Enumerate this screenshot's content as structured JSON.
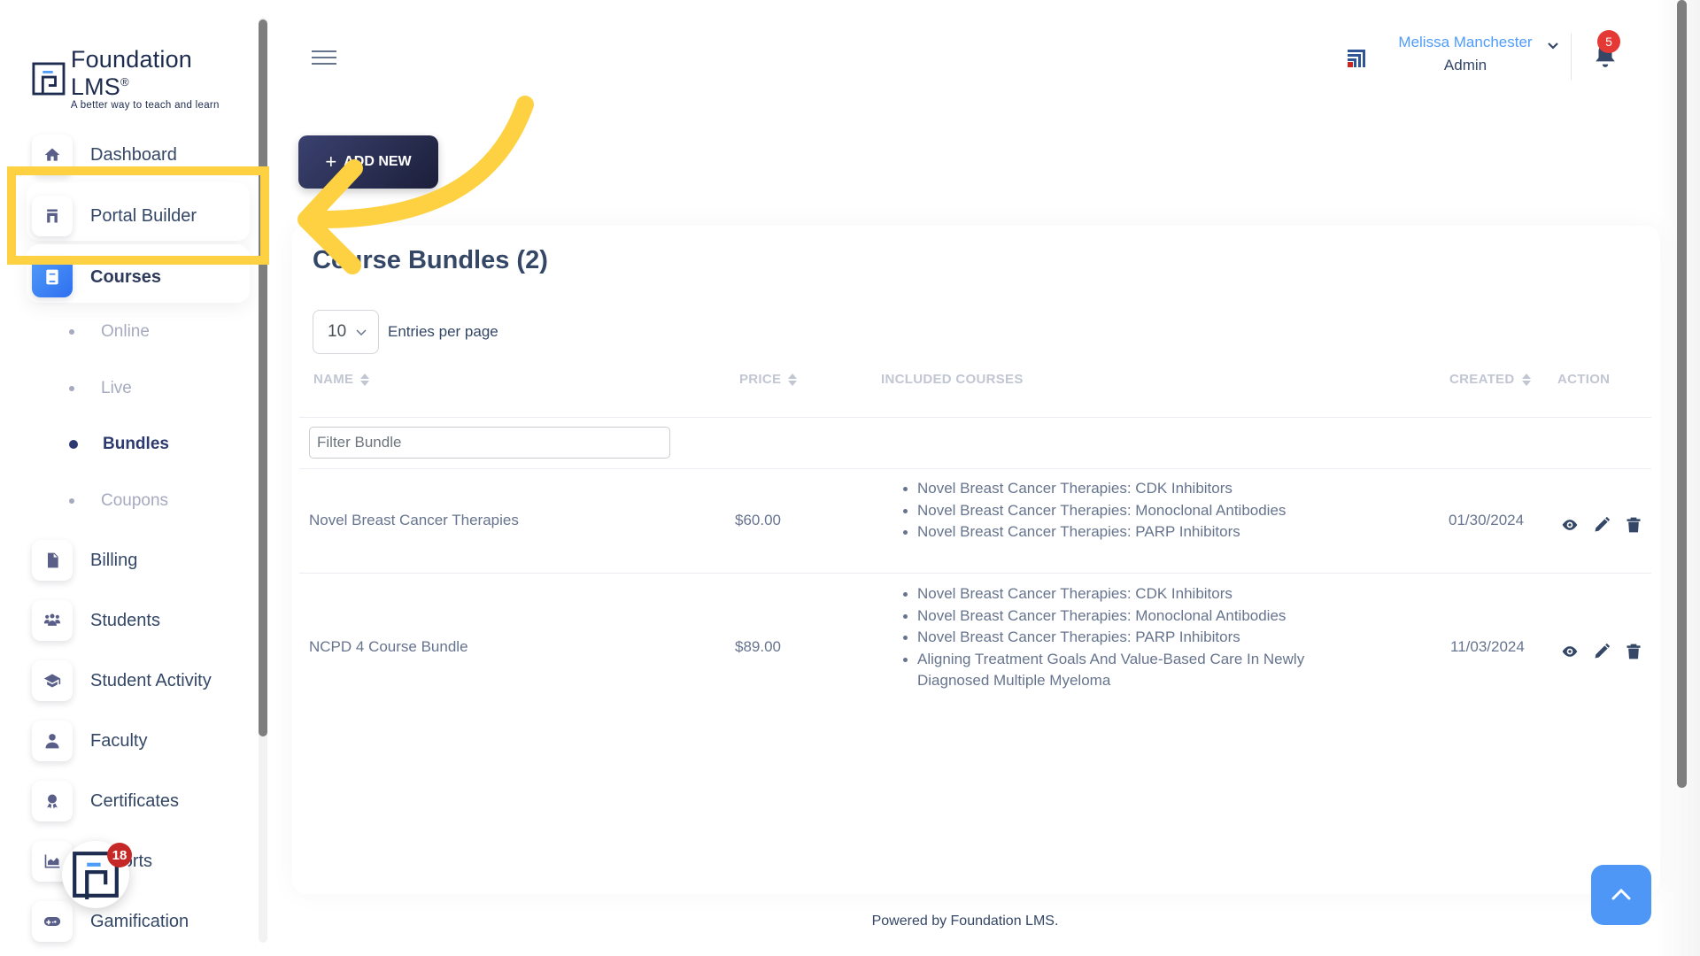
{
  "brand": {
    "name": "Foundation LMS",
    "registered": "®",
    "tagline": "A better way to teach and learn"
  },
  "sidebar": {
    "items": [
      {
        "label": "Dashboard",
        "icon": "home-icon"
      },
      {
        "label": "Portal Builder",
        "icon": "portal-icon"
      },
      {
        "label": "Courses",
        "icon": "book-icon",
        "active": true
      },
      {
        "label": "Billing",
        "icon": "invoice-icon"
      },
      {
        "label": "Students",
        "icon": "users-icon"
      },
      {
        "label": "Student Activity",
        "icon": "graduation-cap-icon"
      },
      {
        "label": "Faculty",
        "icon": "faculty-icon"
      },
      {
        "label": "Certificates",
        "icon": "award-icon"
      },
      {
        "label": "Reports",
        "icon": "area-chart-icon"
      },
      {
        "label": "Gamification",
        "icon": "gamepad-icon"
      }
    ],
    "courses_sub": [
      {
        "label": "Online"
      },
      {
        "label": "Live"
      },
      {
        "label": "Bundles",
        "active": true
      },
      {
        "label": "Coupons"
      }
    ]
  },
  "header": {
    "user_name": "Melissa Manchester",
    "user_role": "Admin",
    "notification_count": "5"
  },
  "toolbar": {
    "add_new_label": "ADD NEW"
  },
  "main": {
    "title": "Course Bundles (2)",
    "entries_per_page_value": "10",
    "entries_per_page_label": "Entries per page",
    "filter_placeholder": "Filter Bundle",
    "columns": [
      "NAME",
      "PRICE",
      "INCLUDED COURSES",
      "CREATED",
      "ACTION"
    ],
    "rows": [
      {
        "name": "Novel Breast Cancer Therapies",
        "price": "$60.00",
        "courses": [
          "Novel Breast Cancer Therapies: CDK Inhibitors",
          "Novel Breast Cancer Therapies: Monoclonal Antibodies",
          "Novel Breast Cancer Therapies: PARP Inhibitors"
        ],
        "created": "01/30/2024"
      },
      {
        "name": "NCPD 4 Course Bundle",
        "price": "$89.00",
        "courses": [
          "Novel Breast Cancer Therapies: CDK Inhibitors",
          "Novel Breast Cancer Therapies: Monoclonal Antibodies",
          "Novel Breast Cancer Therapies: PARP Inhibitors",
          "Aligning Treatment Goals And Value-Based Care In Newly Diagnosed Multiple Myeloma"
        ],
        "created": "11/03/2024"
      }
    ]
  },
  "footer": {
    "text": "Powered by Foundation LMS."
  },
  "widget": {
    "badge_count": "18"
  },
  "colors": {
    "accent": "#4f9cf9",
    "primary_dark": "#344767",
    "annotation": "#fdd142",
    "badge_red": "#e53935"
  }
}
